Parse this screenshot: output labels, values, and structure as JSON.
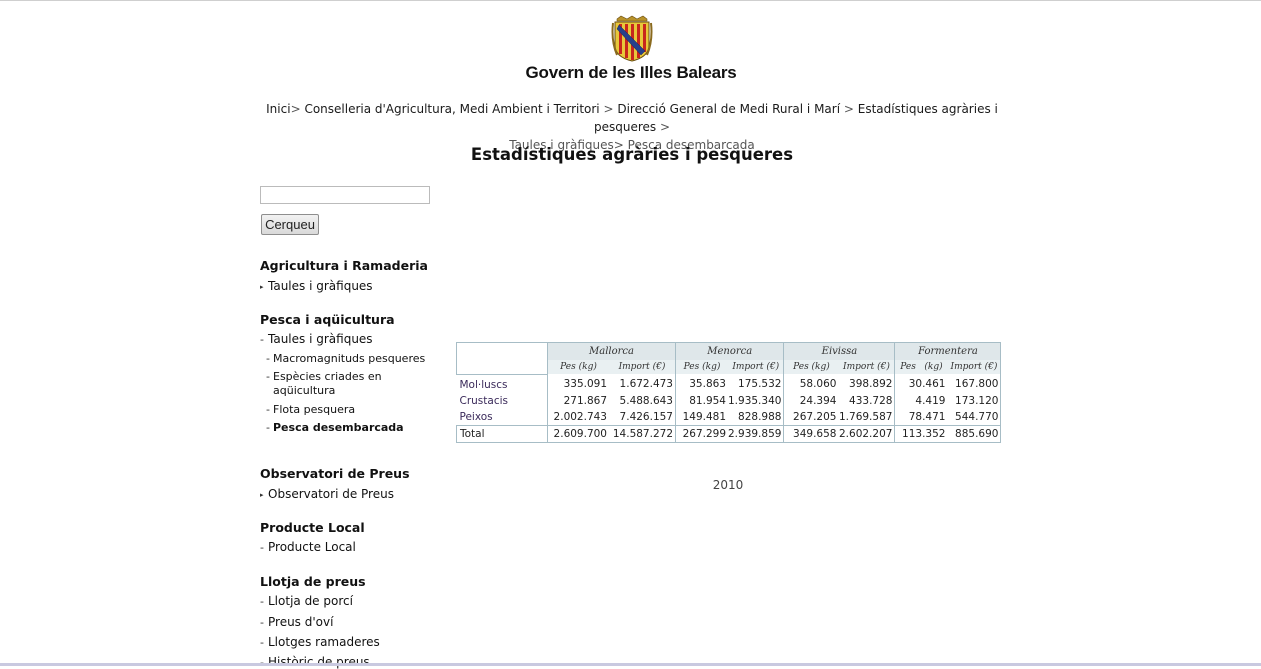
{
  "header": {
    "title": "Govern de les Illes Balears",
    "logo_icon": "coat-of-arms-icon"
  },
  "breadcrumb": {
    "items": [
      "Inici",
      "Conselleria d'Agricultura, Medi Ambient i Territori",
      "Direcció General de Medi Rural i Marí",
      "Estadístiques agràries i pesqueres",
      "Taules i gràfiques",
      "Pesca desembarcada"
    ]
  },
  "page": {
    "title": "Estadístiques agràries i pesqueres"
  },
  "search": {
    "value": "",
    "button_label": "Cerqueu"
  },
  "sidebar": {
    "sections": [
      {
        "title": "Agricultura i Ramaderia",
        "items": [
          "Taules i gràfiques"
        ]
      },
      {
        "title": "Pesca i aqüicultura",
        "items": [
          "Taules i gràfiques"
        ],
        "subitems": [
          "Macromagnituds pesqueres",
          "Espècies criades en aqüicultura",
          "Flota pesquera",
          "Pesca desembarcada"
        ]
      },
      {
        "title": "Observatori de Preus",
        "items": [
          "Observatori de Preus"
        ]
      },
      {
        "title": "Producte Local",
        "items": [
          "Producte Local"
        ]
      },
      {
        "title": "Llotja de preus",
        "items": [
          "Llotja de porcí",
          "Preus d'oví",
          "Llotges ramaderes",
          "Històric de preus"
        ]
      }
    ]
  },
  "table": {
    "groups": [
      "Mallorca",
      "Menorca",
      "Eivissa",
      "Formentera"
    ],
    "subheaders": [
      "Pes (kg)",
      "Import (€)",
      "Pes (kg)",
      "Import (€)",
      "Pes (kg)",
      "Import (€)",
      "Pes   (kg)",
      "Import (€)"
    ],
    "rows": [
      {
        "label": "Mol·luscs",
        "values": [
          "335.091",
          "1.672.473",
          "35.863",
          "175.532",
          "58.060",
          "398.892",
          "30.461",
          "167.800"
        ]
      },
      {
        "label": "Crustacis",
        "values": [
          "271.867",
          "5.488.643",
          "81.954",
          "1.935.340",
          "24.394",
          "433.728",
          "4.419",
          "173.120"
        ]
      },
      {
        "label": "Peixos",
        "values": [
          "2.002.743",
          "7.426.157",
          "149.481",
          "828.988",
          "267.205",
          "1.769.587",
          "78.471",
          "544.770"
        ]
      },
      {
        "label": "Total",
        "values": [
          "2.609.700",
          "14.587.272",
          "267.299",
          "2.939.859",
          "349.658",
          "2.602.207",
          "113.352",
          "885.690"
        ]
      }
    ]
  },
  "year": "2010"
}
